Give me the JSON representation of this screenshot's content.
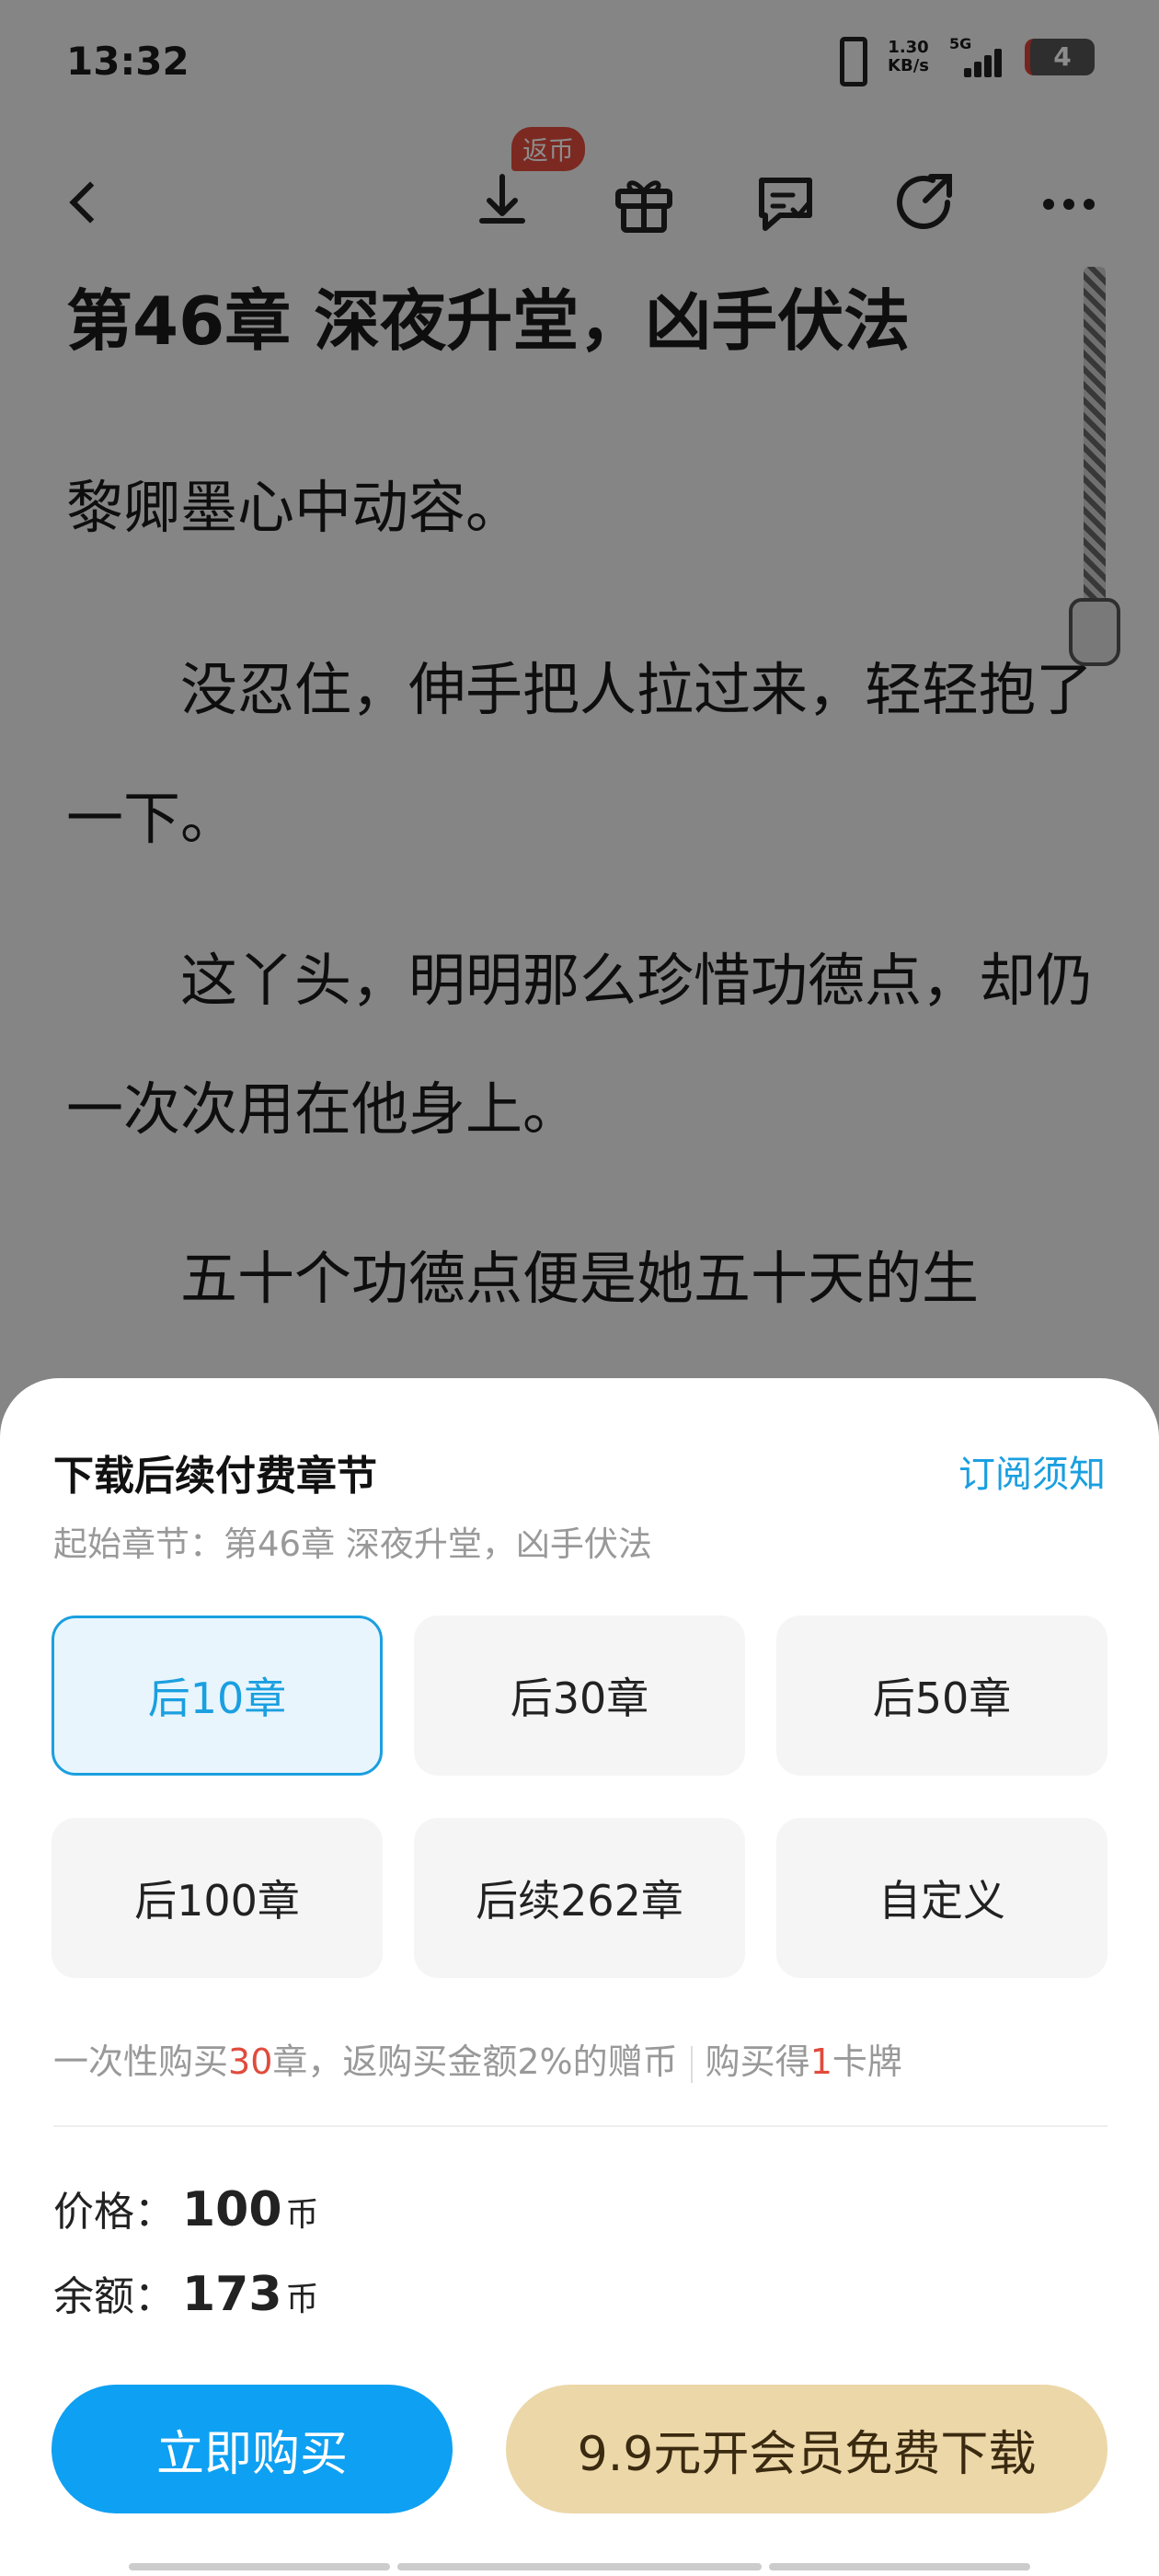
{
  "status_bar": {
    "time": "13:32",
    "net_speed_value": "1.30",
    "net_speed_unit": "KB/s",
    "network_type": "5G",
    "battery": "4"
  },
  "top_bar": {
    "badge": "返币"
  },
  "reader": {
    "chapter_title": "第46章 深夜升堂，凶手伏法",
    "paragraphs": [
      "黎卿墨心中动容。",
      "　　没忍住，伸手把人拉过来，轻轻抱了一下。",
      "　　这丫头，明明那么珍惜功德点，却仍一次次用在他身上。",
      "　　五十个功德点便是她五十天的生"
    ]
  },
  "sheet": {
    "title": "下载后续付费章节",
    "notice_link": "订阅须知",
    "start_chapter": "起始章节：第46章 深夜升堂，凶手伏法",
    "options": [
      {
        "label": "后10章",
        "selected": true
      },
      {
        "label": "后30章",
        "selected": false
      },
      {
        "label": "后50章",
        "selected": false
      },
      {
        "label": "后100章",
        "selected": false
      },
      {
        "label": "后续262章",
        "selected": false
      },
      {
        "label": "自定义",
        "selected": false
      }
    ],
    "promo": {
      "part1": "一次性购买",
      "count": "30",
      "part2": "章，返购买金额2%的赠币",
      "part3": "购买得",
      "cards": "1",
      "part4": "卡牌"
    },
    "price_label": "价格：",
    "price_value": "100",
    "price_unit": "币",
    "balance_label": "余额：",
    "balance_value": "173",
    "balance_unit": "币",
    "buy_button": "立即购买",
    "vip_button": "9.9元开会员免费下载"
  },
  "colors": {
    "accent": "#1a9fe0",
    "buy_button": "#0ea0f2",
    "vip_button": "#ecd7a8",
    "highlight_red": "#e04b3c"
  }
}
